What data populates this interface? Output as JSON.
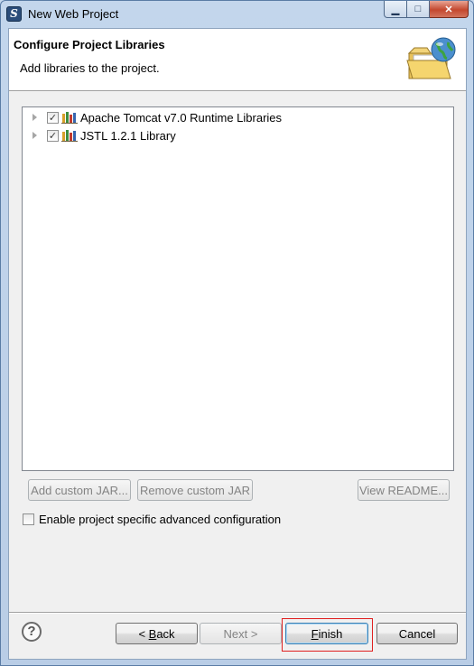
{
  "window": {
    "title": "New Web Project",
    "minimize_glyph": "▁",
    "maximize_glyph": "□",
    "close_glyph": "✕"
  },
  "banner": {
    "title": "Configure Project Libraries",
    "description": "Add libraries to the project.",
    "icon": "folder-globe-icon"
  },
  "libraries": {
    "items": [
      {
        "label": "Apache Tomcat v7.0 Runtime Libraries",
        "checked": true,
        "check_glyph": "✓",
        "icon": "library-icon"
      },
      {
        "label": "JSTL 1.2.1 Library",
        "checked": true,
        "check_glyph": "✓",
        "icon": "library-icon"
      }
    ]
  },
  "buttons": {
    "add_custom_jar": "Add custom JAR...",
    "remove_custom_jar": "Remove custom JAR",
    "view_readme": "View README..."
  },
  "advanced": {
    "label": "Enable project specific advanced configuration",
    "checked": false
  },
  "footer": {
    "help_glyph": "?",
    "back_prefix": "< ",
    "back_mnemonic": "B",
    "back_rest": "ack",
    "next_label": "Next >",
    "finish_mnemonic": "F",
    "finish_rest": "inish",
    "cancel_label": "Cancel"
  },
  "colors": {
    "highlight": "#e02020",
    "client_background": "#f0f0f0",
    "title_bar": "#c3d6ec"
  }
}
